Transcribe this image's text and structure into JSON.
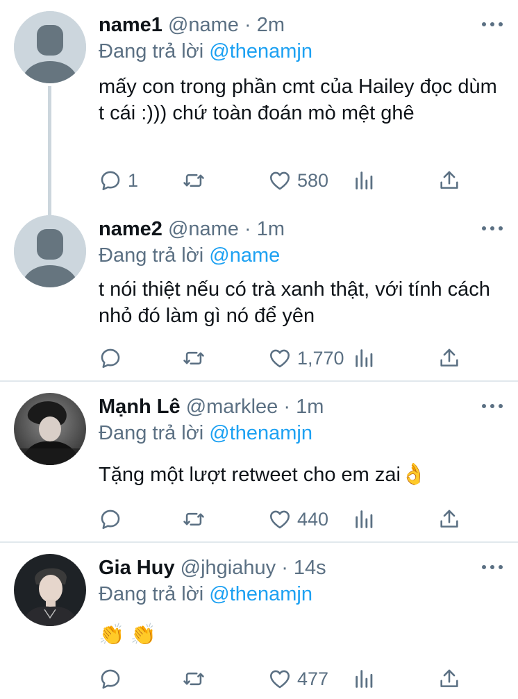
{
  "tweets": [
    {
      "name": "name1",
      "handle": "@name",
      "time": "2m",
      "reply_prefix": "Đang trả lời",
      "reply_to": "@thenamjn",
      "text": "mấy con trong phần cmt của Hailey đọc dùm t cái :))) chứ toàn đoán mò mệt ghê",
      "reply_count": "1",
      "like_count": "580"
    },
    {
      "name": "name2",
      "handle": "@name",
      "time": "1m",
      "reply_prefix": "Đang trả lời",
      "reply_to": "@name",
      "text": "t nói thiệt nếu có trà xanh thật, với tính cách nhỏ đó làm gì nó để yên",
      "reply_count": "",
      "like_count": "1,770"
    },
    {
      "name": "Mạnh Lê",
      "handle": "@marklee",
      "time": "1m",
      "reply_prefix": "Đang trả lời",
      "reply_to": "@thenamjn",
      "text": "Tặng một lượt retweet cho em zai",
      "text_emoji": "👌",
      "reply_count": "",
      "like_count": "440"
    },
    {
      "name": "Gia Huy",
      "handle": "@jhgiahuy",
      "time": "14s",
      "reply_prefix": "Đang trả lời",
      "reply_to": "@thenamjn",
      "text": "👏 👏",
      "reply_count": "",
      "like_count": "477"
    }
  ],
  "separator": "·",
  "icons": [
    "more-icon",
    "reply-icon",
    "retweet-icon",
    "like-icon",
    "analytics-icon",
    "share-icon",
    "default-avatar-icon"
  ],
  "colors": {
    "link": "#1da1f2",
    "secondary": "#5b7083",
    "divider": "#e1e8ed",
    "thread": "#ccd6dd"
  }
}
